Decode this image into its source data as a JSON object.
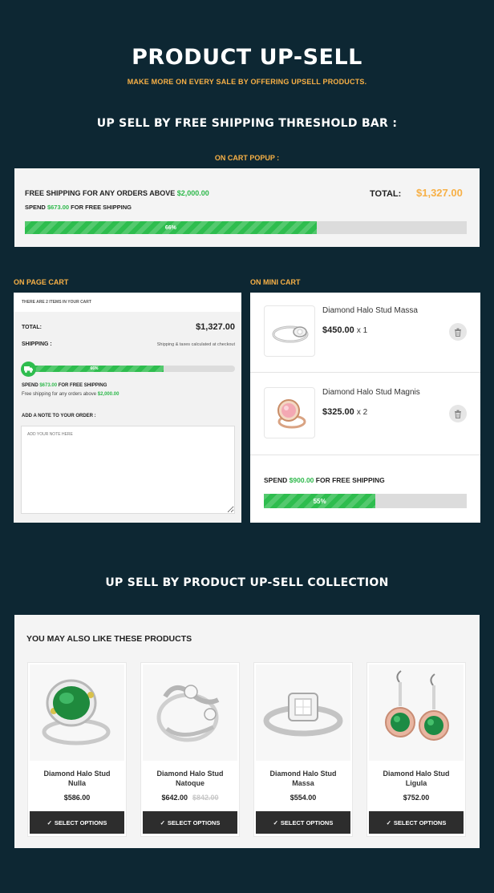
{
  "header": {
    "title": "PRODUCT UP-SELL",
    "subtitle": "MAKE MORE ON EVERY SALE BY OFFERING UPSELL PRODUCTS."
  },
  "section1": {
    "title": "UP SELL BY FREE SHIPPING THRESHOLD BAR :",
    "popup_label": "ON CART POPUP :"
  },
  "popup": {
    "threshold_prefix": "FREE SHIPPING FOR ANY ORDERS ABOVE",
    "threshold_amount": "$2,000.00",
    "spend_prefix": "SPEND",
    "spend_amount": "$673.00",
    "spend_suffix": "FOR FREE SHIPPING",
    "total_label": "TOTAL:",
    "total_value": "$1,327.00",
    "progress_text": "66%",
    "progress": 0.66
  },
  "page_cart": {
    "label": "ON PAGE CART",
    "items_count": "THERE ARE 2 ITEMS IN YOUR CART",
    "total_label": "TOTAL:",
    "total_value": "$1,327.00",
    "shipping_label": "SHIPPING :",
    "shipping_note": "Shipping & taxes calculated at checkout",
    "progress_text": "66%",
    "progress": 0.66,
    "spend_prefix": "SPEND",
    "spend_amount": "$673.00",
    "spend_suffix": "FOR FREE SHIPPING",
    "threshold_prefix": "Free shipping for any orders above",
    "threshold_amount": "$2,000.00",
    "note_label": "ADD A NOTE TO YOUR ORDER :",
    "note_placeholder": "ADD YOUR NOTE HERE"
  },
  "mini_cart": {
    "label": "ON MINI CART",
    "items": [
      {
        "name": "Diamond Halo Stud Massa",
        "price": "$450.00",
        "qty": "x 1"
      },
      {
        "name": "Diamond Halo Stud Magnis",
        "price": "$325.00",
        "qty": "x 2"
      }
    ],
    "spend_prefix": "SPEND",
    "spend_amount": "$900.00",
    "spend_suffix": "FOR FREE SHIPPING",
    "progress_text": "55%",
    "progress": 0.55
  },
  "section2": {
    "title": "UP SELL BY PRODUCT UP-SELL COLLECTION",
    "heading": "YOU MAY ALSO LIKE THESE PRODUCTS"
  },
  "products": [
    {
      "name1": "Diamond Halo Stud",
      "name2": "Nulla",
      "price": "$586.00",
      "old_price": "",
      "button": "SELECT OPTIONS"
    },
    {
      "name1": "Diamond Halo Stud",
      "name2": "Natoque",
      "price": "$642.00",
      "old_price": "$842.00",
      "button": "SELECT OPTIONS"
    },
    {
      "name1": "Diamond Halo Stud",
      "name2": "Massa",
      "price": "$554.00",
      "old_price": "",
      "button": "SELECT OPTIONS"
    },
    {
      "name1": "Diamond Halo Stud",
      "name2": "Ligula",
      "price": "$752.00",
      "old_price": "",
      "button": "SELECT OPTIONS"
    }
  ],
  "colors": {
    "background": "#0d2733",
    "accent_orange": "#f7b046",
    "green": "#2ebd4e",
    "dark_button": "#2d2d2d"
  },
  "icons": [
    "truck-icon",
    "trash-icon",
    "check-icon"
  ]
}
